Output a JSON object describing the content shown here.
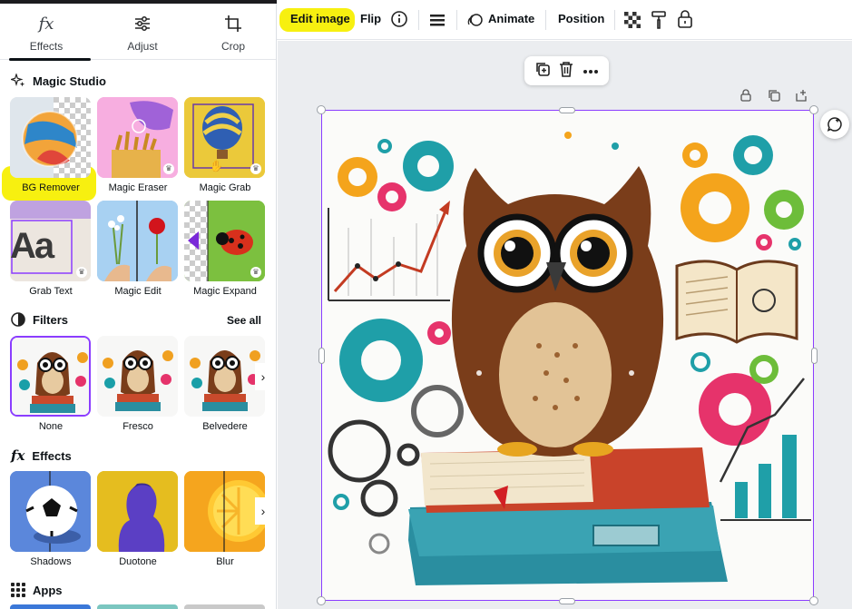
{
  "panel": {
    "tabs": [
      {
        "label": "Effects",
        "icon": "fx-icon",
        "active": true
      },
      {
        "label": "Adjust",
        "icon": "sliders-icon"
      },
      {
        "label": "Crop",
        "icon": "crop-icon"
      }
    ],
    "fx_glyph": "fx",
    "magic_studio": {
      "title": "Magic Studio",
      "tools": [
        {
          "label": "BG Remover",
          "highlighted": true
        },
        {
          "label": "Magic Eraser"
        },
        {
          "label": "Magic Grab"
        },
        {
          "label": "Grab Text"
        },
        {
          "label": "Magic Edit"
        },
        {
          "label": "Magic Expand"
        }
      ],
      "grab_text_glyph": "Aa"
    },
    "filters": {
      "title": "Filters",
      "see_all": "See all",
      "items": [
        {
          "label": "None",
          "selected": true
        },
        {
          "label": "Fresco"
        },
        {
          "label": "Belvedere"
        }
      ]
    },
    "effects": {
      "title": "Effects",
      "items": [
        {
          "label": "Shadows"
        },
        {
          "label": "Duotone"
        },
        {
          "label": "Blur"
        }
      ]
    },
    "apps": {
      "title": "Apps"
    }
  },
  "toolbar": {
    "edit_image": "Edit image",
    "flip": "Flip",
    "animate": "Animate",
    "position": "Position"
  },
  "colors": {
    "highlight": "#f7f010",
    "selection": "#8b3dff",
    "canvas_bg": "#ebedf0"
  }
}
